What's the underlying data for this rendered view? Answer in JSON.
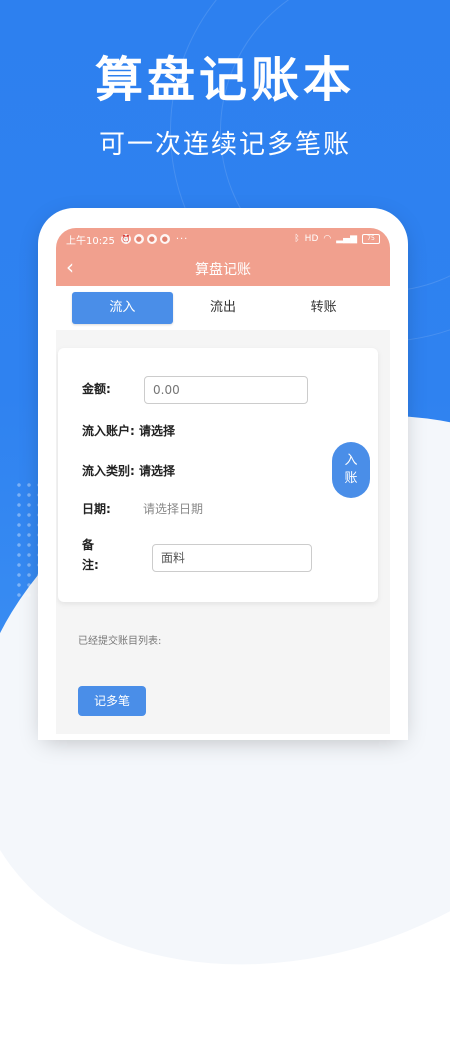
{
  "promo": {
    "title": "算盘记账本",
    "subtitle": "可一次连续记多笔账"
  },
  "statusbar": {
    "time": "上午10:25",
    "more": "···",
    "network": "HD",
    "battery": "75"
  },
  "appbar": {
    "back_icon": "‹",
    "title": "算盘记账"
  },
  "tabs": [
    {
      "label": "流入",
      "active": true
    },
    {
      "label": "流出",
      "active": false
    },
    {
      "label": "转账",
      "active": false
    }
  ],
  "form": {
    "amount_label": "金额:",
    "amount_placeholder": "0.00",
    "account_label": "流入账户:",
    "account_value": "请选择",
    "category_label": "流入类别:",
    "category_value": "请选择",
    "date_label": "日期:",
    "date_placeholder": "请选择日期",
    "note_label_1": "备",
    "note_label_2": "注:",
    "note_value": "面料"
  },
  "submit": {
    "line1": "入",
    "line2": "账"
  },
  "list": {
    "label": "已经提交账目列表:"
  },
  "multi_button": "记多笔",
  "colors": {
    "brand_blue": "#2f82f0",
    "header_salmon": "#f1a08e",
    "button_blue": "#4a8ee8"
  }
}
